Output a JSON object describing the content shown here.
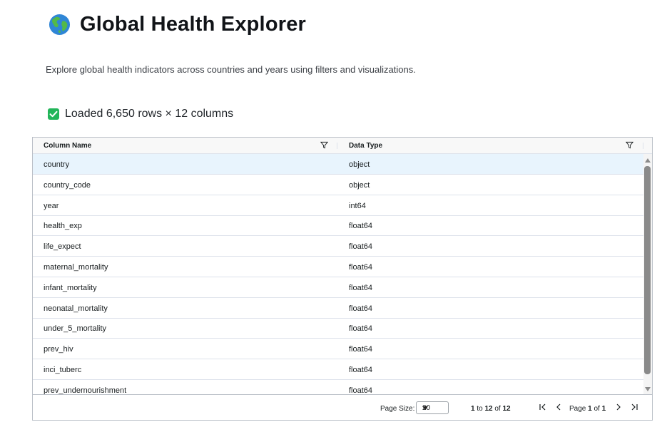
{
  "header": {
    "title": "Global Health Explorer",
    "globe_icon": "globe-earth-icon",
    "description": "Explore global health indicators across countries and years using filters and visualizations."
  },
  "status": {
    "icon": "checkbox-check-icon",
    "text": "Loaded 6,650 rows × 12 columns",
    "color": "#22b559"
  },
  "grid": {
    "columns": [
      "Column Name",
      "Data Type"
    ],
    "rows": [
      {
        "name": "country",
        "dtype": "object"
      },
      {
        "name": "country_code",
        "dtype": "object"
      },
      {
        "name": "year",
        "dtype": "int64"
      },
      {
        "name": "health_exp",
        "dtype": "float64"
      },
      {
        "name": "life_expect",
        "dtype": "float64"
      },
      {
        "name": "maternal_mortality",
        "dtype": "float64"
      },
      {
        "name": "infant_mortality",
        "dtype": "float64"
      },
      {
        "name": "neonatal_mortality",
        "dtype": "float64"
      },
      {
        "name": "under_5_mortality",
        "dtype": "float64"
      },
      {
        "name": "prev_hiv",
        "dtype": "float64"
      },
      {
        "name": "inci_tuberc",
        "dtype": "float64"
      },
      {
        "name": "prev_undernourishment",
        "dtype": "float64"
      }
    ],
    "selected_row_color": "#e8f4fd"
  },
  "pagination": {
    "page_size_label": "Page Size:",
    "page_size": "20",
    "range_from": "1",
    "range_to_word": "to",
    "range_to": "12",
    "of_word": "of",
    "total": "12",
    "page_word": "Page",
    "page_current": "1",
    "page_of_word": "of",
    "page_total": "1"
  }
}
